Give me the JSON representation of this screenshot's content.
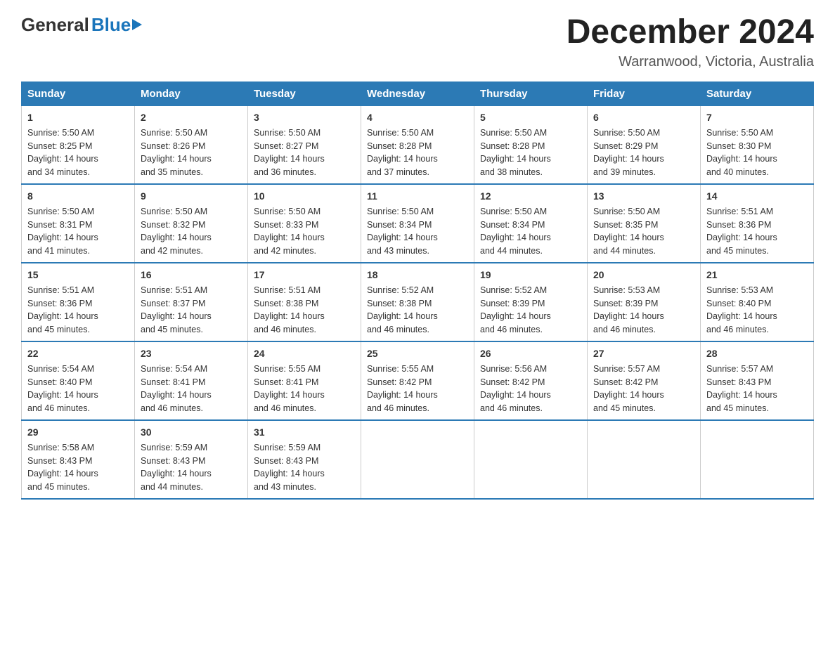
{
  "logo": {
    "general": "General",
    "blue": "Blue",
    "tagline": ""
  },
  "title": "December 2024",
  "subtitle": "Warranwood, Victoria, Australia",
  "headers": [
    "Sunday",
    "Monday",
    "Tuesday",
    "Wednesday",
    "Thursday",
    "Friday",
    "Saturday"
  ],
  "weeks": [
    [
      {
        "day": "1",
        "sunrise": "5:50 AM",
        "sunset": "8:25 PM",
        "daylight": "14 hours and 34 minutes."
      },
      {
        "day": "2",
        "sunrise": "5:50 AM",
        "sunset": "8:26 PM",
        "daylight": "14 hours and 35 minutes."
      },
      {
        "day": "3",
        "sunrise": "5:50 AM",
        "sunset": "8:27 PM",
        "daylight": "14 hours and 36 minutes."
      },
      {
        "day": "4",
        "sunrise": "5:50 AM",
        "sunset": "8:28 PM",
        "daylight": "14 hours and 37 minutes."
      },
      {
        "day": "5",
        "sunrise": "5:50 AM",
        "sunset": "8:28 PM",
        "daylight": "14 hours and 38 minutes."
      },
      {
        "day": "6",
        "sunrise": "5:50 AM",
        "sunset": "8:29 PM",
        "daylight": "14 hours and 39 minutes."
      },
      {
        "day": "7",
        "sunrise": "5:50 AM",
        "sunset": "8:30 PM",
        "daylight": "14 hours and 40 minutes."
      }
    ],
    [
      {
        "day": "8",
        "sunrise": "5:50 AM",
        "sunset": "8:31 PM",
        "daylight": "14 hours and 41 minutes."
      },
      {
        "day": "9",
        "sunrise": "5:50 AM",
        "sunset": "8:32 PM",
        "daylight": "14 hours and 42 minutes."
      },
      {
        "day": "10",
        "sunrise": "5:50 AM",
        "sunset": "8:33 PM",
        "daylight": "14 hours and 42 minutes."
      },
      {
        "day": "11",
        "sunrise": "5:50 AM",
        "sunset": "8:34 PM",
        "daylight": "14 hours and 43 minutes."
      },
      {
        "day": "12",
        "sunrise": "5:50 AM",
        "sunset": "8:34 PM",
        "daylight": "14 hours and 44 minutes."
      },
      {
        "day": "13",
        "sunrise": "5:50 AM",
        "sunset": "8:35 PM",
        "daylight": "14 hours and 44 minutes."
      },
      {
        "day": "14",
        "sunrise": "5:51 AM",
        "sunset": "8:36 PM",
        "daylight": "14 hours and 45 minutes."
      }
    ],
    [
      {
        "day": "15",
        "sunrise": "5:51 AM",
        "sunset": "8:36 PM",
        "daylight": "14 hours and 45 minutes."
      },
      {
        "day": "16",
        "sunrise": "5:51 AM",
        "sunset": "8:37 PM",
        "daylight": "14 hours and 45 minutes."
      },
      {
        "day": "17",
        "sunrise": "5:51 AM",
        "sunset": "8:38 PM",
        "daylight": "14 hours and 46 minutes."
      },
      {
        "day": "18",
        "sunrise": "5:52 AM",
        "sunset": "8:38 PM",
        "daylight": "14 hours and 46 minutes."
      },
      {
        "day": "19",
        "sunrise": "5:52 AM",
        "sunset": "8:39 PM",
        "daylight": "14 hours and 46 minutes."
      },
      {
        "day": "20",
        "sunrise": "5:53 AM",
        "sunset": "8:39 PM",
        "daylight": "14 hours and 46 minutes."
      },
      {
        "day": "21",
        "sunrise": "5:53 AM",
        "sunset": "8:40 PM",
        "daylight": "14 hours and 46 minutes."
      }
    ],
    [
      {
        "day": "22",
        "sunrise": "5:54 AM",
        "sunset": "8:40 PM",
        "daylight": "14 hours and 46 minutes."
      },
      {
        "day": "23",
        "sunrise": "5:54 AM",
        "sunset": "8:41 PM",
        "daylight": "14 hours and 46 minutes."
      },
      {
        "day": "24",
        "sunrise": "5:55 AM",
        "sunset": "8:41 PM",
        "daylight": "14 hours and 46 minutes."
      },
      {
        "day": "25",
        "sunrise": "5:55 AM",
        "sunset": "8:42 PM",
        "daylight": "14 hours and 46 minutes."
      },
      {
        "day": "26",
        "sunrise": "5:56 AM",
        "sunset": "8:42 PM",
        "daylight": "14 hours and 46 minutes."
      },
      {
        "day": "27",
        "sunrise": "5:57 AM",
        "sunset": "8:42 PM",
        "daylight": "14 hours and 45 minutes."
      },
      {
        "day": "28",
        "sunrise": "5:57 AM",
        "sunset": "8:43 PM",
        "daylight": "14 hours and 45 minutes."
      }
    ],
    [
      {
        "day": "29",
        "sunrise": "5:58 AM",
        "sunset": "8:43 PM",
        "daylight": "14 hours and 45 minutes."
      },
      {
        "day": "30",
        "sunrise": "5:59 AM",
        "sunset": "8:43 PM",
        "daylight": "14 hours and 44 minutes."
      },
      {
        "day": "31",
        "sunrise": "5:59 AM",
        "sunset": "8:43 PM",
        "daylight": "14 hours and 43 minutes."
      },
      null,
      null,
      null,
      null
    ]
  ],
  "labels": {
    "sunrise_prefix": "Sunrise: ",
    "sunset_prefix": "Sunset: ",
    "daylight_prefix": "Daylight: "
  }
}
